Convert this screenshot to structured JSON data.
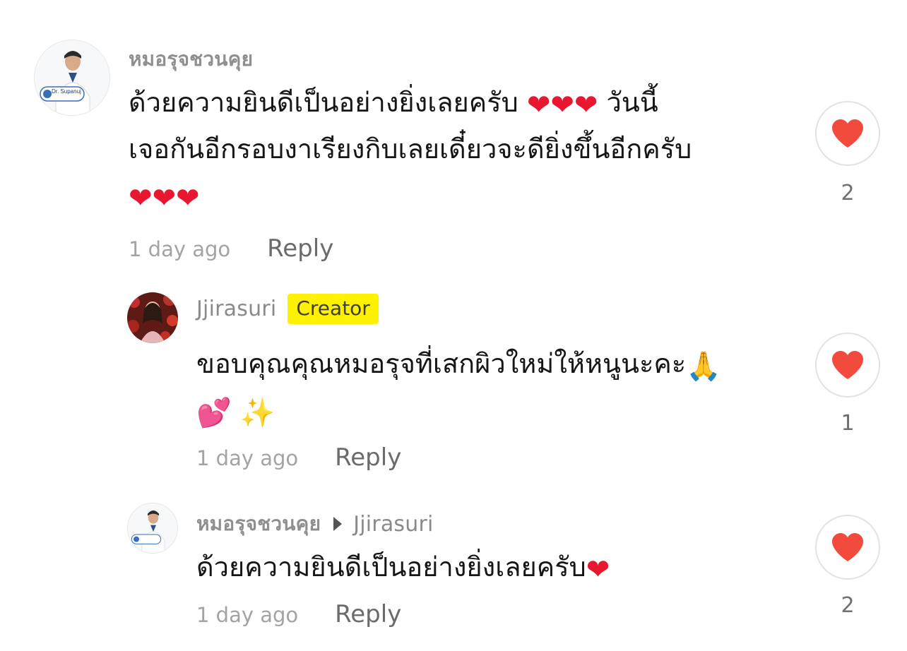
{
  "comments": [
    {
      "username": "หมอรุจชวนคุย",
      "avatar_badge": "Dr. Supanuj",
      "lines": [
        "ด้วยความยินดีเป็นอย่างยิ่งเลยครับ",
        "วันนี้",
        "เจอกันอีกรอบงาเรียงกิบเลยเดี๋ยวจะดียิ่งขึ้นอีกครับ"
      ],
      "emoji_heart": "❤",
      "time": "1 day ago",
      "reply_label": "Reply",
      "like_count": "2"
    },
    {
      "username": "Jjirasuri",
      "badge": "Creator",
      "lines": [
        "ขอบคุณคุณหมอรุจที่เสกผิวใหม่ให้หนูนะคะ"
      ],
      "emoji_pray": "🙏",
      "emoji_pink_hearts": "💕",
      "emoji_sparkles": "✨",
      "time": "1 day ago",
      "reply_label": "Reply",
      "like_count": "1"
    },
    {
      "username": "หมอรุจชวนคุย",
      "reply_to": "Jjirasuri",
      "avatar_badge": "Dr. Supanuj",
      "lines": [
        "ด้วยความยินดีเป็นอย่างยิ่งเลยครับ"
      ],
      "emoji_heart": "❤",
      "time": "1 day ago",
      "reply_label": "Reply",
      "like_count": "2"
    }
  ],
  "colors": {
    "like_heart": "#f24a3c",
    "creator_badge": "#fff200",
    "emoji_heart": "#e8172f"
  },
  "icons": {
    "like": "heart-icon",
    "reply_to": "caret-right-icon"
  }
}
